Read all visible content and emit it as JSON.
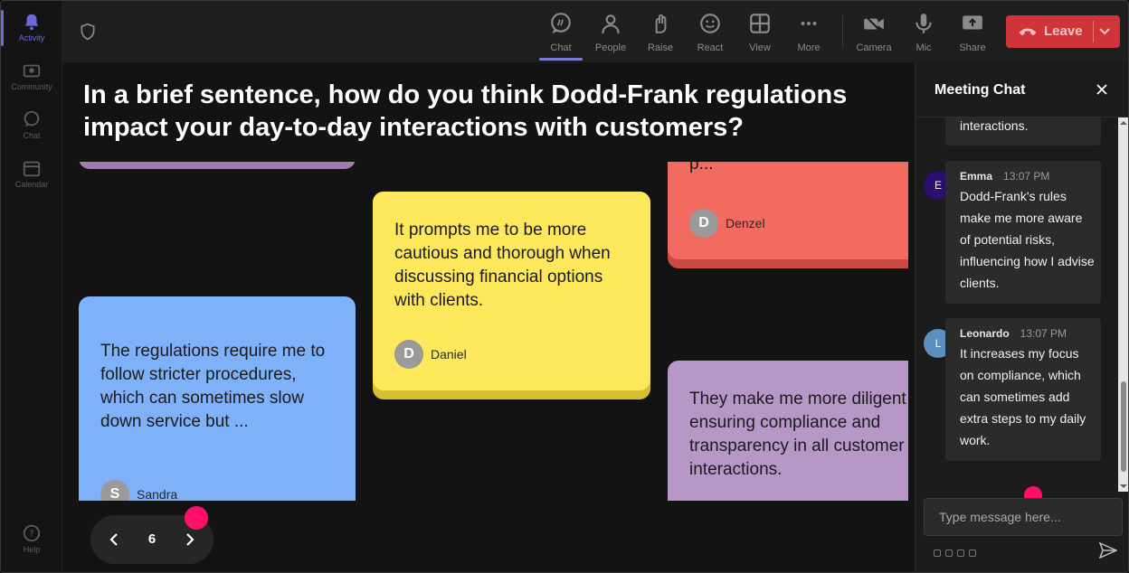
{
  "rail": {
    "items": [
      {
        "label": "Activity",
        "icon": "bell-icon",
        "active": true
      },
      {
        "label": "Community",
        "icon": "community-icon"
      },
      {
        "label": "Chat",
        "icon": "chat-icon"
      },
      {
        "label": "Calendar",
        "icon": "calendar-icon"
      }
    ],
    "help_label": "Help"
  },
  "toolbar": {
    "chat": "Chat",
    "people": "People",
    "raise": "Raise",
    "react": "React",
    "view": "View",
    "more": "More",
    "camera": "Camera",
    "mic": "Mic",
    "share": "Share",
    "leave": "Leave"
  },
  "stage": {
    "question": "In a brief sentence, how do you think Dodd-Frank regulations impact your day-to-day interactions with customers?",
    "cards": {
      "denzel": {
        "text": "p...",
        "initial": "D",
        "name": "Denzel"
      },
      "daniel": {
        "text": "It prompts me to be more cautious and thorough when discussing financial options with clients.",
        "initial": "D",
        "name": "Daniel"
      },
      "sandra": {
        "text": "The regulations require me to follow stricter procedures, which can sometimes slow down service but ...",
        "initial": "S",
        "name": "Sandra"
      },
      "purple": {
        "text": "They make me more diligent in ensuring compliance and transparency in all customer interactions."
      }
    },
    "page": "6"
  },
  "chat": {
    "title": "Meeting Chat",
    "top_fragment": "interactions.",
    "messages": [
      {
        "initial": "E",
        "name": "Emma",
        "time": "13:07 PM",
        "text": "Dodd-Frank's rules make me more aware of potential risks, influencing how I advise clients."
      },
      {
        "initial": "L",
        "name": "Leonardo",
        "time": "13:07 PM",
        "text": "It increases my focus on compliance, which can sometimes add extra steps to my daily work."
      }
    ],
    "placeholder": "Type message here..."
  },
  "colors": {
    "leave": "#d13438",
    "accent": "#6b6bd6",
    "card_yellow": "#fde75a",
    "card_blue": "#7fb1f8",
    "card_red": "#f26b60",
    "card_purple": "#b697c6",
    "pink_marker": "#ff0f6b"
  }
}
